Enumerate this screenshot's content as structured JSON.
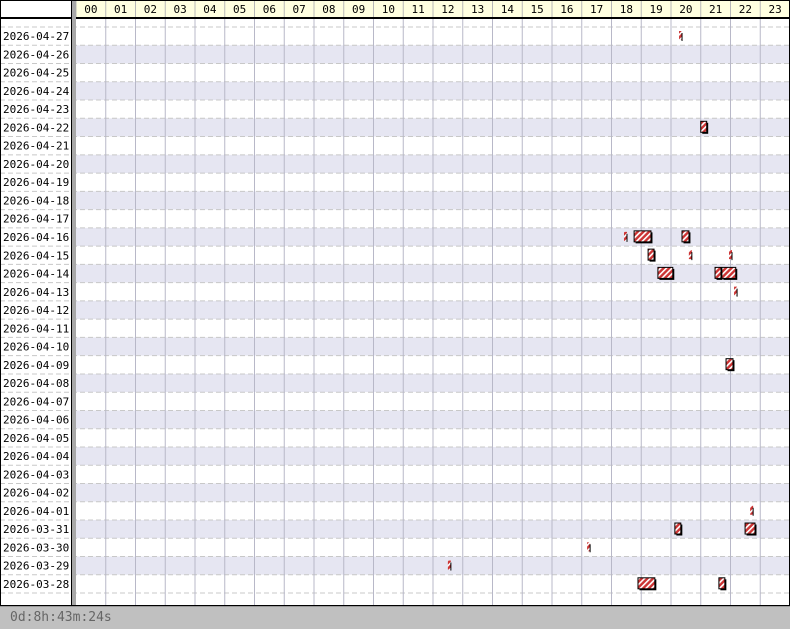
{
  "chart_data": {
    "type": "bar",
    "orientation": "horizontal-timeline",
    "xlabel": "hour of day",
    "hours": [
      "00",
      "01",
      "02",
      "03",
      "04",
      "05",
      "06",
      "07",
      "08",
      "09",
      "10",
      "11",
      "12",
      "13",
      "14",
      "15",
      "16",
      "17",
      "18",
      "19",
      "20",
      "21",
      "22",
      "23"
    ],
    "dates": [
      "2026-04-27",
      "2026-04-26",
      "2026-04-25",
      "2026-04-24",
      "2026-04-23",
      "2026-04-22",
      "2026-04-21",
      "2026-04-20",
      "2026-04-19",
      "2026-04-18",
      "2026-04-17",
      "2026-04-16",
      "2026-04-15",
      "2026-04-14",
      "2026-04-13",
      "2026-04-12",
      "2026-04-11",
      "2026-04-10",
      "2026-04-09",
      "2026-04-08",
      "2026-04-07",
      "2026-04-06",
      "2026-04-05",
      "2026-04-04",
      "2026-04-03",
      "2026-04-02",
      "2026-04-01",
      "2026-03-31",
      "2026-03-30",
      "2026-03-29",
      "2026-03-28"
    ],
    "events": [
      {
        "date": "2026-04-27",
        "start_hour": 20.27,
        "duration_min": 3
      },
      {
        "date": "2026-04-26",
        "start_hour": 0,
        "duration_min": 3
      },
      {
        "date": "2026-04-25",
        "start_hour": 0,
        "duration_min": 3
      },
      {
        "date": "2026-04-24",
        "start_hour": 0,
        "duration_min": 3
      },
      {
        "date": "2026-04-23",
        "start_hour": 0,
        "duration_min": 3
      },
      {
        "date": "2026-04-22",
        "start_hour": 0,
        "duration_min": 3
      },
      {
        "date": "2026-04-22",
        "start_hour": 21.0,
        "duration_min": 12
      },
      {
        "date": "2026-04-21",
        "start_hour": 0,
        "duration_min": 3
      },
      {
        "date": "2026-04-20",
        "start_hour": 0,
        "duration_min": 3
      },
      {
        "date": "2026-04-19",
        "start_hour": 0,
        "duration_min": 3
      },
      {
        "date": "2026-04-18",
        "start_hour": 0,
        "duration_min": 3
      },
      {
        "date": "2026-04-17",
        "start_hour": 0,
        "duration_min": 3
      },
      {
        "date": "2026-04-16",
        "start_hour": 0,
        "duration_min": 3
      },
      {
        "date": "2026-04-16",
        "start_hour": 18.42,
        "duration_min": 3
      },
      {
        "date": "2026-04-16",
        "start_hour": 18.76,
        "duration_min": 34
      },
      {
        "date": "2026-04-16",
        "start_hour": 20.37,
        "duration_min": 14
      },
      {
        "date": "2026-04-15",
        "start_hour": 19.23,
        "duration_min": 12
      },
      {
        "date": "2026-04-15",
        "start_hour": 20.6,
        "duration_min": 3
      },
      {
        "date": "2026-04-15",
        "start_hour": 21.95,
        "duration_min": 3
      },
      {
        "date": "2026-04-14",
        "start_hour": 19.56,
        "duration_min": 30
      },
      {
        "date": "2026-04-14",
        "start_hour": 21.48,
        "duration_min": 12
      },
      {
        "date": "2026-04-14",
        "start_hour": 21.71,
        "duration_min": 28
      },
      {
        "date": "2026-04-13",
        "start_hour": 22.12,
        "duration_min": 3
      },
      {
        "date": "2026-04-12",
        "start_hour": 0,
        "duration_min": 3
      },
      {
        "date": "2026-04-11",
        "start_hour": 0,
        "duration_min": 3
      },
      {
        "date": "2026-04-10",
        "start_hour": 0,
        "duration_min": 3
      },
      {
        "date": "2026-04-09",
        "start_hour": 0,
        "duration_min": 3
      },
      {
        "date": "2026-04-09",
        "start_hour": 21.85,
        "duration_min": 14
      },
      {
        "date": "2026-04-08",
        "start_hour": 0,
        "duration_min": 3
      },
      {
        "date": "2026-04-07",
        "start_hour": 0,
        "duration_min": 3
      },
      {
        "date": "2026-04-06",
        "start_hour": 0,
        "duration_min": 3
      },
      {
        "date": "2026-04-05",
        "start_hour": 0,
        "duration_min": 3
      },
      {
        "date": "2026-04-04",
        "start_hour": 0,
        "duration_min": 3
      },
      {
        "date": "2026-04-03",
        "start_hour": 0,
        "duration_min": 3
      },
      {
        "date": "2026-04-02",
        "start_hour": 0,
        "duration_min": 3
      },
      {
        "date": "2026-04-01",
        "start_hour": 22.66,
        "duration_min": 3
      },
      {
        "date": "2026-03-31",
        "start_hour": 0,
        "duration_min": 3
      },
      {
        "date": "2026-03-31",
        "start_hour": 20.13,
        "duration_min": 12
      },
      {
        "date": "2026-03-31",
        "start_hour": 22.49,
        "duration_min": 20
      },
      {
        "date": "2026-03-30",
        "start_hour": 0,
        "duration_min": 3
      },
      {
        "date": "2026-03-30",
        "start_hour": 17.18,
        "duration_min": 3
      },
      {
        "date": "2026-03-29",
        "start_hour": 0,
        "duration_min": 3
      },
      {
        "date": "2026-03-29",
        "start_hour": 12.5,
        "duration_min": 3
      },
      {
        "date": "2026-03-28",
        "start_hour": 18.89,
        "duration_min": 34
      },
      {
        "date": "2026-03-28",
        "start_hour": 21.61,
        "duration_min": 12
      }
    ],
    "colors": {
      "event": "#cc3333",
      "header_bg": "#ffffe0",
      "row_alt": "#e6e6f2"
    }
  },
  "footer": {
    "total_duration": "0d:8h:43m:24s"
  }
}
